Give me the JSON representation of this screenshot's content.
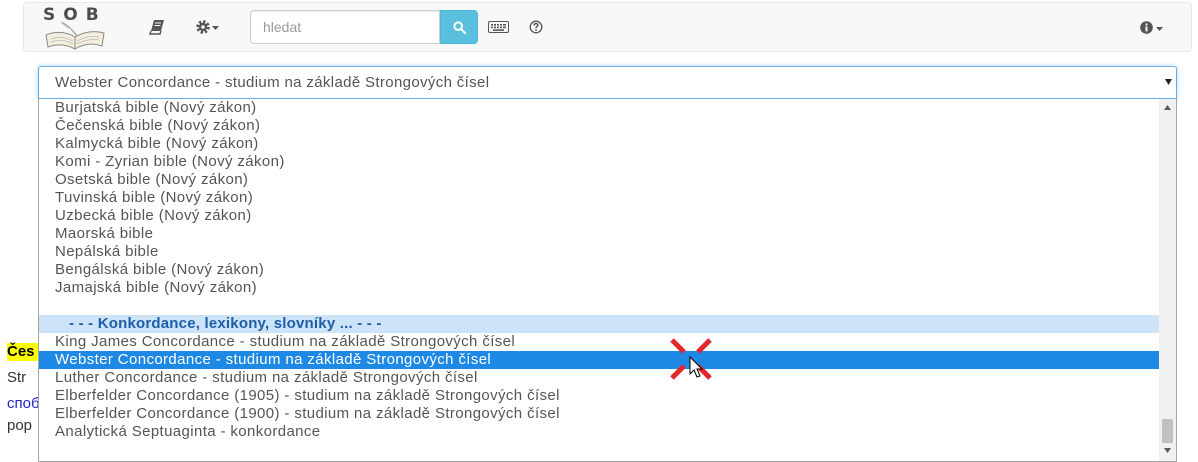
{
  "navbar": {
    "logo_text": "SOB",
    "search_placeholder": "hledat",
    "icons": {
      "logo": "open-book-logo-icon",
      "bible": "book-icon",
      "settings": "gear-icon",
      "search": "search-icon",
      "keyboard": "keyboard-icon",
      "help": "question-circle-icon",
      "info": "info-icon"
    }
  },
  "select": {
    "value": "Webster Concordance - studium na základě Strongových čísel"
  },
  "dropdown": {
    "options": [
      "Burjatská bible (Nový zákon)",
      "Čečenská bible (Nový zákon)",
      "Kalmycká bible (Nový zákon)",
      "Komi - Zyrian bible (Nový zákon)",
      "Osetská bible (Nový zákon)",
      "Tuvinská bible (Nový zákon)",
      "Uzbecká bible (Nový zákon)",
      "Maorská bible",
      "Nepálská bible",
      "Bengálská bible (Nový zákon)",
      "Jamajská bible (Nový zákon)"
    ],
    "group_label": "- - - Konkordance, lexikony, slovníky ... - - -",
    "group_options": [
      "King James Concordance - studium na základě Strongových čísel",
      "Webster Concordance - studium na základě Strongových čísel",
      "Luther Concordance - studium na základě Strongových čísel",
      "Elberfelder Concordance (1905) - studium na základě Strongových čísel",
      "Elberfelder Concordance (1900) - studium na základě Strongových čísel",
      "Analytická Septuaginta - konkordance"
    ]
  },
  "page_behind": {
    "heading_fragment": "Čes",
    "lines": [
      "Str",
      "споб",
      "pop"
    ]
  },
  "colors": {
    "selected_bg": "#1e88e5",
    "group_bg": "#cde3f8",
    "group_text": "#1d5ea9",
    "search_btn": "#5bc0de",
    "highlight": "#ffff00",
    "link": "#2424c8",
    "marker": "#e3262b"
  }
}
